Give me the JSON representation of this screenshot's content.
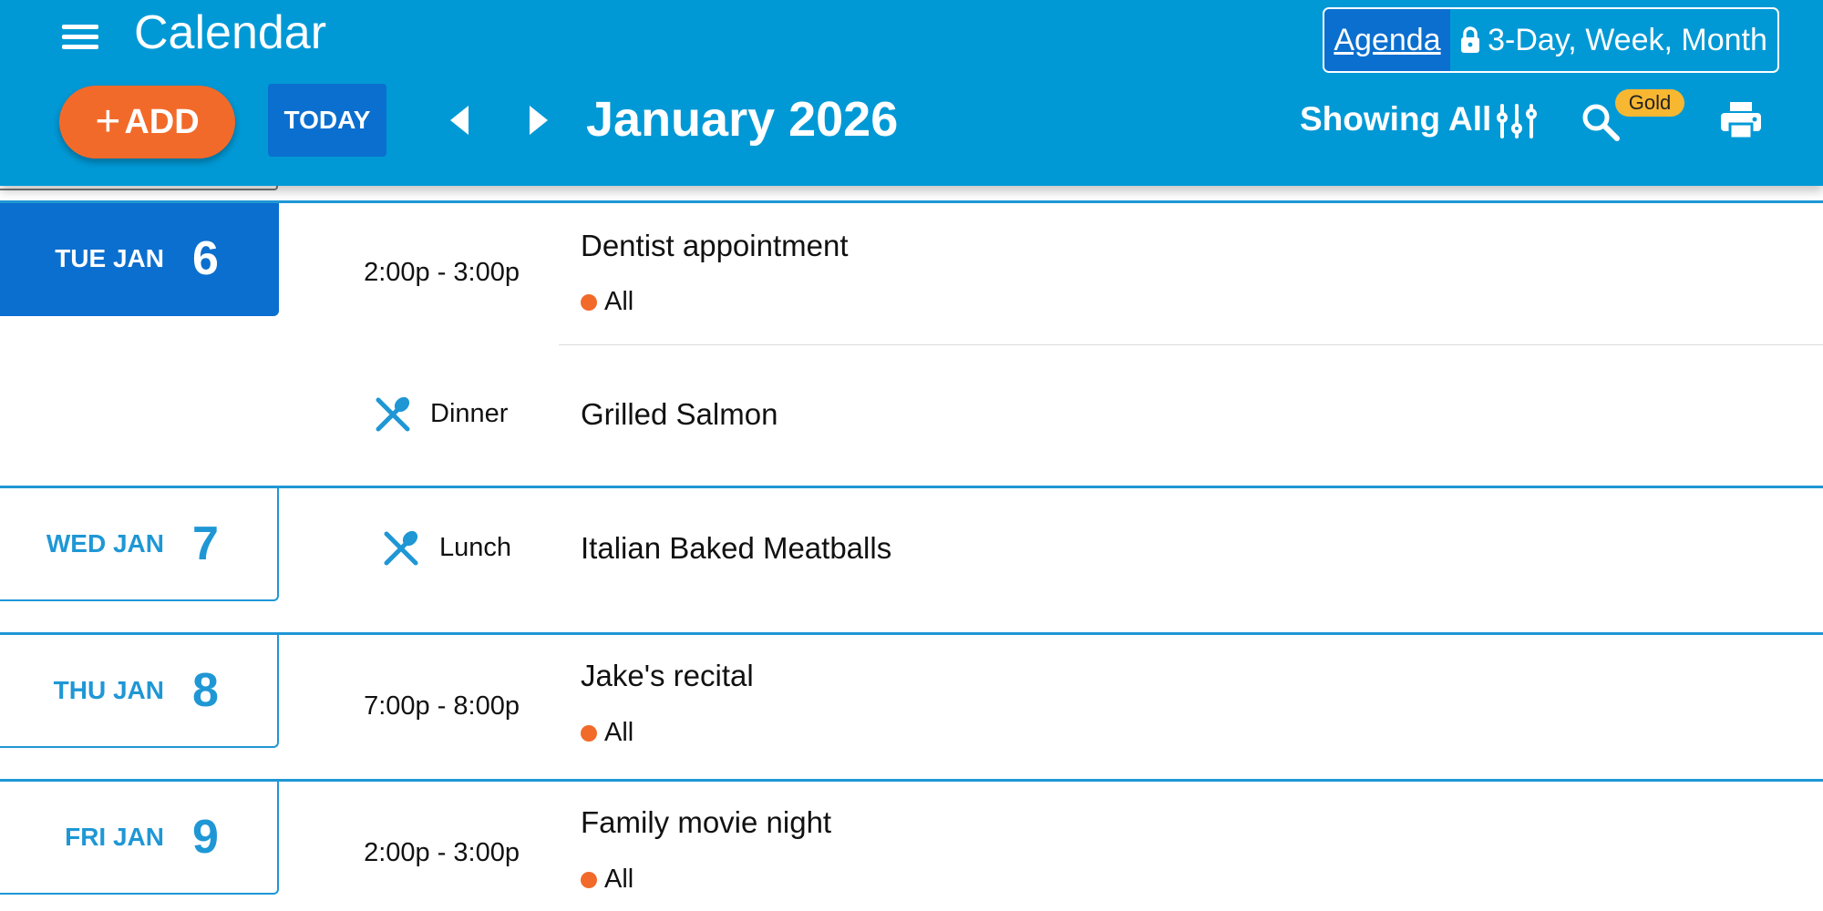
{
  "header": {
    "app_title": "Calendar",
    "view_switch": {
      "active": "Agenda",
      "locked": "3-Day, Week, Month"
    },
    "add_label": "ADD",
    "add_plus": "+",
    "today_label": "TODAY",
    "month_title": "January 2026",
    "filter_label": "Showing All",
    "search_badge": "Gold",
    "colors": {
      "bar": "#0099d6",
      "add": "#f26a2a",
      "today": "#0b6fcf",
      "badge": "#f7b731"
    },
    "icons": [
      "hamburger-menu-icon",
      "lock-icon",
      "chevron-left-icon",
      "chevron-right-icon",
      "filter-sliders-icon",
      "search-icon",
      "print-icon"
    ]
  },
  "days": [
    {
      "label": "TUE JAN",
      "num": "6",
      "today": true,
      "events": [
        {
          "time": "2:00p - 3:00p",
          "title": "Dentist appointment",
          "calendar": "All"
        },
        {
          "meal": "Dinner",
          "title": "Grilled Salmon"
        }
      ]
    },
    {
      "label": "WED JAN",
      "num": "7",
      "events": [
        {
          "meal": "Lunch",
          "title": "Italian Baked Meatballs"
        }
      ]
    },
    {
      "label": "THU JAN",
      "num": "8",
      "events": [
        {
          "time": "7:00p - 8:00p",
          "title": "Jake's recital",
          "calendar": "All"
        }
      ]
    },
    {
      "label": "FRI JAN",
      "num": "9",
      "events": [
        {
          "time": "2:00p - 3:00p",
          "title": "Family movie night",
          "calendar": "All"
        }
      ]
    }
  ]
}
